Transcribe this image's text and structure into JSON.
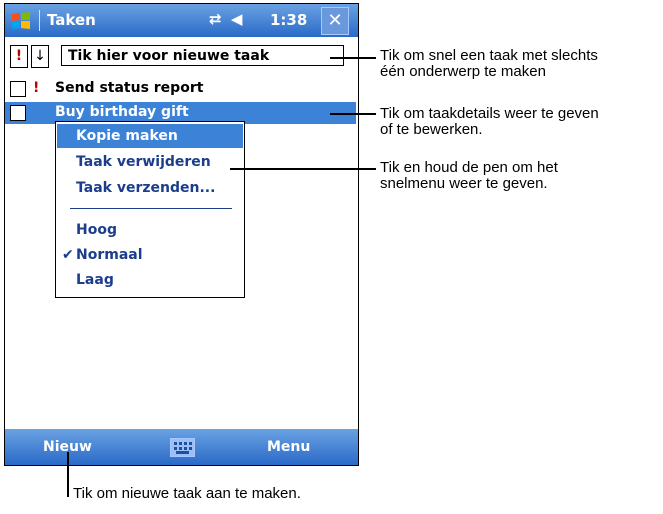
{
  "app": {
    "title": "Taken",
    "time": "1:38"
  },
  "icons": {
    "start": "windows-flag-icon",
    "connectivity": "connectivity-arrows-icon",
    "volume": "speaker-icon",
    "close": "close-icon",
    "keyboard": "keyboard-icon",
    "check": "checkmark-icon"
  },
  "entry": {
    "priority_symbol": "!",
    "sort_symbol": "↓",
    "placeholder": "Tik hier voor nieuwe taak"
  },
  "tasks": [
    {
      "label": "Send status report",
      "priority_symbol": "!"
    },
    {
      "label": "Buy birthday gift"
    }
  ],
  "context_menu": {
    "items": [
      {
        "label": "Kopie maken"
      },
      {
        "label": "Taak verwijderen"
      },
      {
        "label": "Taak verzenden..."
      }
    ],
    "priority_items": [
      {
        "label": "Hoog"
      },
      {
        "label": "Normaal",
        "checked": true
      },
      {
        "label": "Laag"
      }
    ],
    "check_symbol": "✔"
  },
  "bottombar": {
    "new_label": "Nieuw",
    "menu_label": "Menu"
  },
  "callouts": {
    "entry": [
      "Tik om snel een taak met slechts",
      "één onderwerp te maken"
    ],
    "details": [
      "Tik om taakdetails weer te geven",
      "of te bewerken."
    ],
    "hold": [
      "Tik en houd de pen om het",
      "snelmenu weer te geven."
    ],
    "new": "Tik om nieuwe taak aan te maken."
  },
  "colors": {
    "accent": "#3c82d6",
    "priority": "#c00000"
  }
}
